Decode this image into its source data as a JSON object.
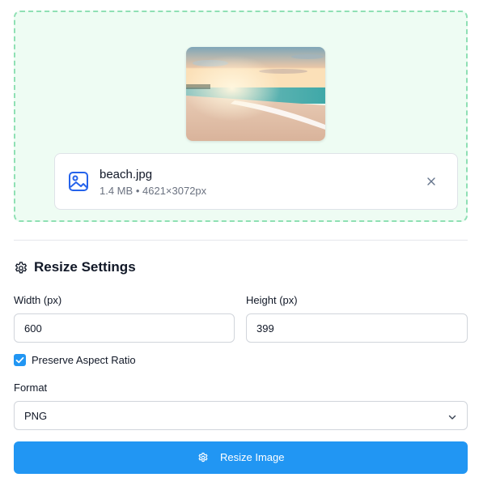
{
  "file": {
    "name": "beach.jpg",
    "size": "1.4 MB",
    "separator": "•",
    "dimensions": "4621×3072px"
  },
  "settings": {
    "title": "Resize Settings",
    "width_label": "Width (px)",
    "width_value": "600",
    "height_label": "Height (px)",
    "height_value": "399",
    "aspect_label": "Preserve Aspect Ratio",
    "aspect_checked": true,
    "format_label": "Format",
    "format_value": "PNG"
  },
  "actions": {
    "resize_label": "Resize Image"
  },
  "colors": {
    "accent": "#2196f3",
    "dropzone_bg": "#eefcf3",
    "dropzone_border": "#8fe0b4"
  },
  "icons": {
    "file": "image-icon",
    "remove": "close-icon",
    "settings": "gear-icon",
    "check": "check-icon",
    "select": "chevron-down-icon"
  }
}
